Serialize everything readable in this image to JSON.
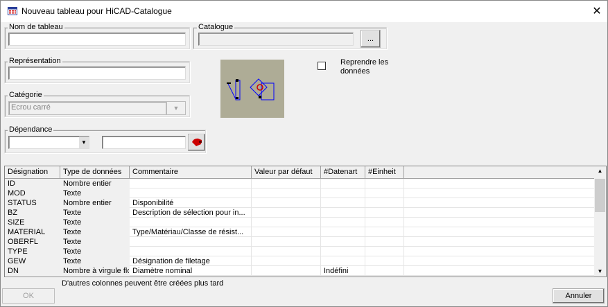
{
  "window": {
    "title": "Nouveau tableau pour HiCAD-Catalogue"
  },
  "nom_de_tableau": {
    "label": "Nom de tableau",
    "value": ""
  },
  "catalogue": {
    "label": "Catalogue",
    "value": "",
    "browse_label": "..."
  },
  "representation": {
    "label": "Représentation",
    "value": ""
  },
  "categorie": {
    "label": "Catégorie",
    "value": "Ecrou carré"
  },
  "dependance": {
    "label": "Dépendance",
    "select_value": "",
    "text_value": ""
  },
  "reprendre": {
    "label": "Reprendre les données",
    "checked": false
  },
  "table": {
    "columns": [
      "Désignation",
      "Type de données",
      "Commentaire",
      "Valeur par défaut",
      "#Datenart",
      "#Einheit"
    ],
    "rows": [
      [
        "ID",
        "Nombre entier",
        "",
        "",
        "",
        ""
      ],
      [
        "MOD",
        "Texte",
        "",
        "",
        "",
        ""
      ],
      [
        "STATUS",
        "Nombre entier",
        "Disponibilité",
        "",
        "",
        ""
      ],
      [
        "BZ",
        "Texte",
        "Description de sélection pour in...",
        "",
        "",
        ""
      ],
      [
        "SIZE",
        "Texte",
        "",
        "",
        "",
        ""
      ],
      [
        "MATERIAL",
        "Texte",
        "Type/Matériau/Classe de résist...",
        "",
        "",
        ""
      ],
      [
        "OBERFL",
        "Texte",
        "",
        "",
        "",
        ""
      ],
      [
        "TYPE",
        "Texte",
        "",
        "",
        "",
        ""
      ],
      [
        "GEW",
        "Texte",
        "Désignation de filetage",
        "",
        "",
        ""
      ],
      [
        "DN",
        "Nombre à virgule flottante",
        "Diamètre nominal",
        "",
        "Indéfini",
        ""
      ]
    ]
  },
  "hint": "D'autres colonnes peuvent être créées plus tard",
  "buttons": {
    "ok": "OK",
    "cancel": "Annuler"
  }
}
